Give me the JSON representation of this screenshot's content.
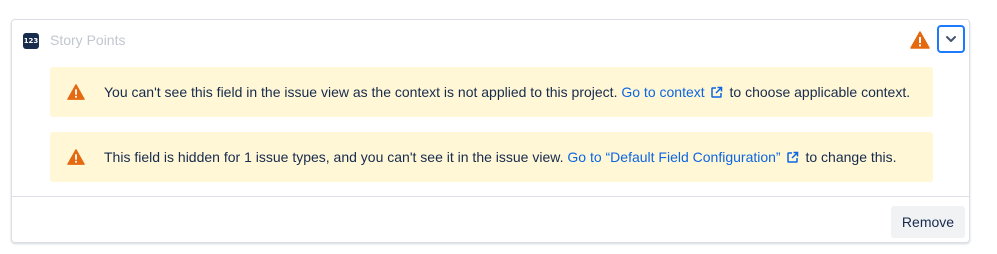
{
  "field": {
    "icon_text": "123",
    "icon_name": "number-field-icon",
    "name": "Story Points"
  },
  "header": {
    "warning_icon": "warning-icon",
    "toggle_icon": "chevron-down-icon"
  },
  "banners": [
    {
      "icon": "warning-icon",
      "text_before": "You can't see this field in the issue view as the context is not applied to this project.",
      "link_text": "Go to context",
      "link_icon": "external-link-icon",
      "text_after": "to choose applicable context."
    },
    {
      "icon": "warning-icon",
      "text_before": "This field is hidden for 1 issue types, and you can't see it in the issue view.",
      "link_text": "Go to “Default Field Configuration”",
      "link_icon": "external-link-icon",
      "text_after": "to change this."
    }
  ],
  "footer": {
    "remove_label": "Remove"
  },
  "colors": {
    "warning": "#e56910",
    "banner_bg": "#fff7d6",
    "link": "#0c66e4",
    "focus": "#1d7afc"
  }
}
